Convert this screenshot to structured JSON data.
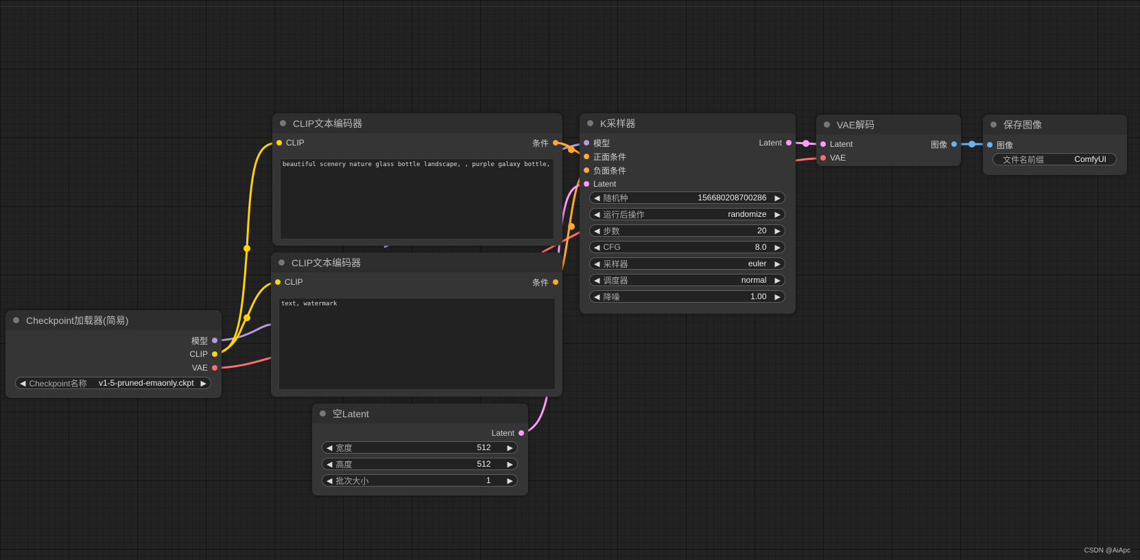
{
  "watermark": "CSDN @AiApc",
  "colors": {
    "model": "#b39ddb",
    "clip": "#ffd500",
    "vae": "#ff6e6e",
    "conditioning": "#ffa931",
    "latent": "#ff9cf9",
    "image": "#64b5f6"
  },
  "nodes": {
    "clip_pos": {
      "title": "CLIP文本编码器",
      "input_clip": "CLIP",
      "output": "条件",
      "text": "beautiful scenery nature glass bottle landscape, , purple galaxy bottle,"
    },
    "clip_neg": {
      "title": "CLIP文本编码器",
      "input_clip": "CLIP",
      "output": "条件",
      "text": "text, watermark"
    },
    "checkpoint": {
      "title": "Checkpoint加载器(简易)",
      "outputs": [
        "模型",
        "CLIP",
        "VAE"
      ],
      "widget_label": "Checkpoint名称",
      "widget_value": "v1-5-pruned-emaonly.ckpt"
    },
    "ksampler": {
      "title": "K采样器",
      "inputs": [
        "模型",
        "正面条件",
        "负面条件",
        "Latent"
      ],
      "output": "Latent",
      "widgets": [
        {
          "label": "随机种",
          "value": "156680208700286"
        },
        {
          "label": "运行后操作",
          "value": "randomize"
        },
        {
          "label": "步数",
          "value": "20"
        },
        {
          "label": "CFG",
          "value": "8.0"
        },
        {
          "label": "采样器",
          "value": "euler"
        },
        {
          "label": "调度器",
          "value": "normal"
        },
        {
          "label": "降噪",
          "value": "1.00"
        }
      ]
    },
    "empty_latent": {
      "title": "空Latent",
      "output": "Latent",
      "widgets": [
        {
          "label": "宽度",
          "value": "512"
        },
        {
          "label": "高度",
          "value": "512"
        },
        {
          "label": "批次大小",
          "value": "1"
        }
      ]
    },
    "vae_decode": {
      "title": "VAE解码",
      "inputs": [
        "Latent",
        "VAE"
      ],
      "output": "图像"
    },
    "save_image": {
      "title": "保存图像",
      "input": "图像",
      "widget_label": "文件名前缀",
      "widget_value": "ComfyUI"
    }
  }
}
